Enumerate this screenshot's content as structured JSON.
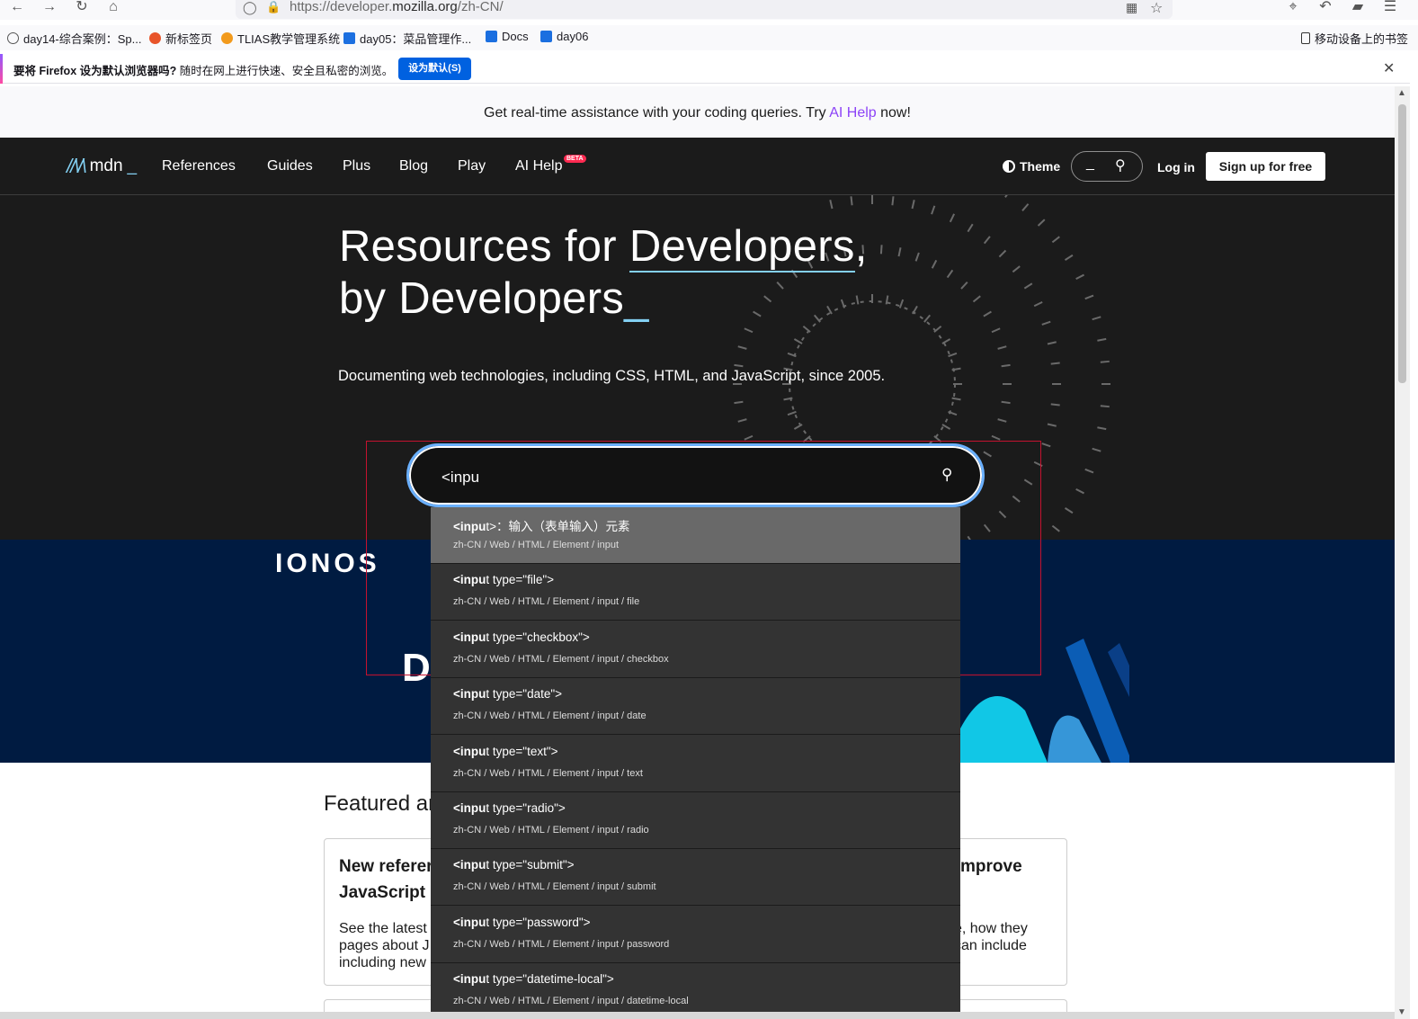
{
  "browser": {
    "url_prefix": "https://developer.",
    "url_domain": "mozilla.org",
    "url_path": "/zh-CN/"
  },
  "bookmarks": [
    {
      "label": "day14-综合案例：Sp...",
      "color": "#555"
    },
    {
      "label": "新标签页",
      "color": "#e8542a"
    },
    {
      "label": "TLIAS教学管理系统",
      "color": "#f29a1c"
    },
    {
      "label": "day05：菜品管理作...",
      "color": "#1b6fe0"
    },
    {
      "label": "Docs",
      "color": "#1b6fe0"
    },
    {
      "label": "day06",
      "color": "#1b6fe0"
    }
  ],
  "mobile_bookmarks": "移动设备上的书签",
  "notification": {
    "bold": "要将 Firefox 设为默认浏览器吗?",
    "text": " 随时在网上进行快速、安全且私密的浏览。",
    "button": "设为默认(S)"
  },
  "ai_banner": {
    "before": "Get real-time assistance with your coding queries. Try ",
    "link": "AI Help",
    "after": " now!"
  },
  "header": {
    "logo": "mdn",
    "nav": [
      "References",
      "Guides",
      "Plus",
      "Blog",
      "Play",
      "AI Help"
    ],
    "beta": "BETA",
    "theme": "Theme",
    "search_placeholder": "_",
    "login": "Log in",
    "signup": "Sign up for free"
  },
  "hero": {
    "title_1a": "Resources for ",
    "title_1b": "Developers",
    "title_1c": ",",
    "title_2": "by Developers",
    "cursor": "_",
    "subtitle": "Documenting web technologies, including CSS, HTML, and JavaScript, since 2005."
  },
  "search": {
    "value": "<inpu",
    "match": "<inpu"
  },
  "suggestions": [
    {
      "rest": "t>：输入（表单输入）元素",
      "path": "zh-CN / Web / HTML / Element / input",
      "active": true
    },
    {
      "rest": "t type=\"file\">",
      "path": "zh-CN / Web / HTML / Element / input / file"
    },
    {
      "rest": "t type=\"checkbox\">",
      "path": "zh-CN / Web / HTML / Element / input / checkbox"
    },
    {
      "rest": "t type=\"date\">",
      "path": "zh-CN / Web / HTML / Element / input / date"
    },
    {
      "rest": "t type=\"text\">",
      "path": "zh-CN / Web / HTML / Element / input / text"
    },
    {
      "rest": "t type=\"radio\">",
      "path": "zh-CN / Web / HTML / Element / input / radio"
    },
    {
      "rest": "t type=\"submit\">",
      "path": "zh-CN / Web / HTML / Element / input / submit"
    },
    {
      "rest": "t type=\"password\">",
      "path": "zh-CN / Web / HTML / Element / input / password"
    },
    {
      "rest": "t type=\"datetime-local\">",
      "path": "zh-CN / Web / HTML / Element / input / datetime-local"
    }
  ],
  "ad": {
    "logo": "IONOS",
    "headline_start": "D"
  },
  "featured": {
    "title": "Featured ar",
    "card1_title": "New referer\nJavaScript r",
    "card1_text": "See the latest\npages about J\nincluding new",
    "card2_title": "mprove",
    "card2_text": "e, how they\ncan include"
  }
}
